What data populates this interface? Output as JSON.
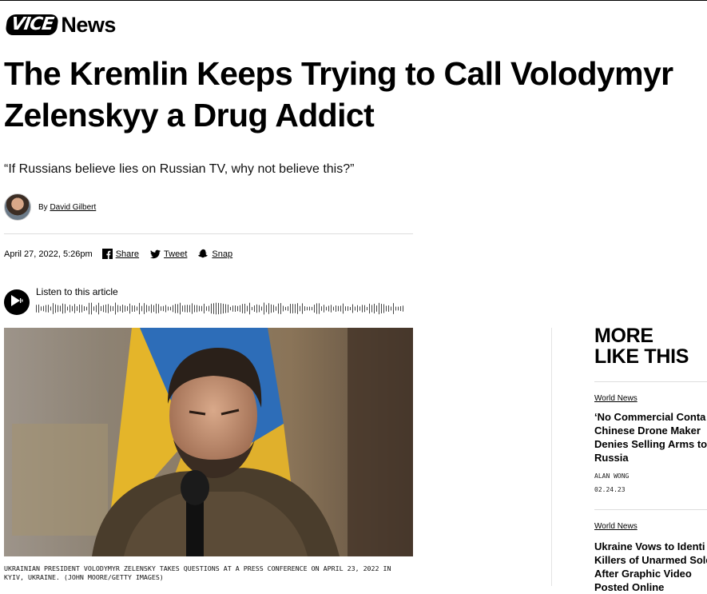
{
  "brand": {
    "logo_text": "VICE",
    "section": "News"
  },
  "article": {
    "headline": "The Kremlin Keeps Trying to Call Volodymyr Zelenskyy a Drug Addict",
    "dek": "“If Russians believe lies on Russian TV, why not believe this?”",
    "by_prefix": "By",
    "author": "David Gilbert",
    "date": "April 27, 2022, 5:26pm",
    "caption": "Ukrainian President Volodymyr Zelensky takes questions at a press conference on April 23, 2022 in Kyiv, Ukraine. (John Moore/Getty Images)"
  },
  "share": {
    "facebook_label": "Share",
    "twitter_label": "Tweet",
    "snapchat_label": "Snap"
  },
  "audio": {
    "label": "Listen to this article"
  },
  "more": {
    "title": "MORE\nLIKE THIS",
    "cards": [
      {
        "category": "World News",
        "title": "‘No Commercial Conta\nChinese Drone Maker\nDenies Selling Arms to\nRussia",
        "author": "ALAN WONG",
        "date": "02.24.23"
      },
      {
        "category": "World News",
        "title": "Ukraine Vows to Identi\nKillers of Unarmed Sold\nAfter Graphic Video\nPosted Online",
        "author": "",
        "date": ""
      }
    ]
  },
  "icons": {
    "play": "play-icon",
    "facebook": "facebook-icon",
    "twitter": "twitter-icon",
    "snapchat": "snapchat-icon"
  }
}
